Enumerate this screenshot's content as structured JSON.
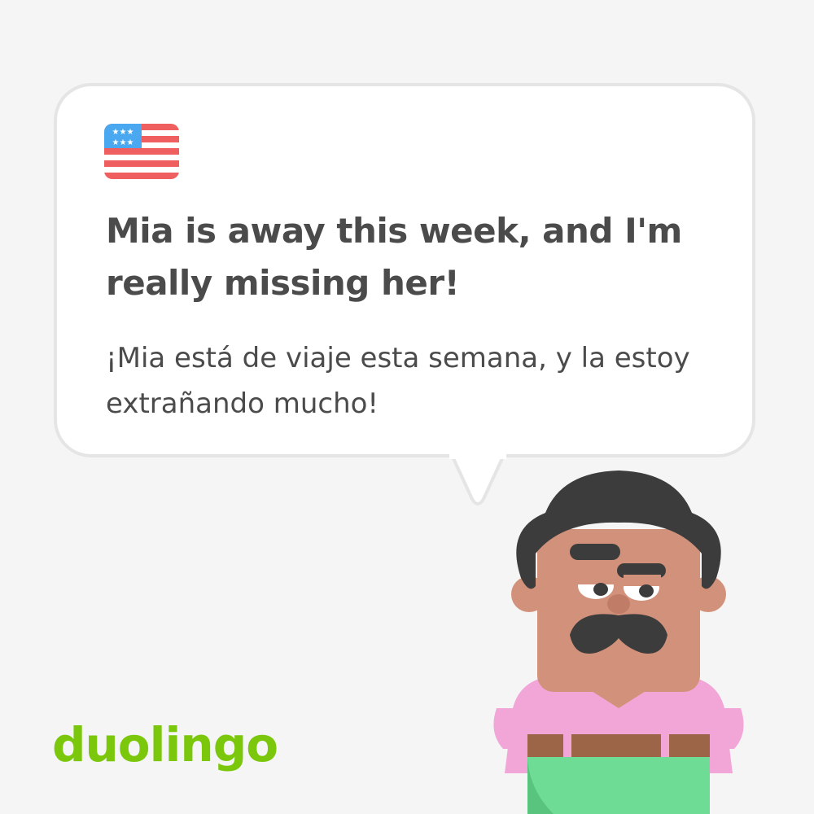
{
  "card": {
    "source_language_flag": "us-flag-icon",
    "sentence_english": "Mia is away this week, and I'm really missing her!",
    "sentence_spanish": "¡Mia está de viaje esta semana, y la estoy extrañando mucho!"
  },
  "brand": {
    "logo_text": "duolingo",
    "logo_color": "#7ac70c"
  },
  "character": {
    "name_icon": "mustached-man-character",
    "shirt_color": "#f2a6d8",
    "pants_color": "#6fdc95",
    "skin_color": "#d2917a",
    "hair_color": "#3c3c3c"
  },
  "colors": {
    "background": "#f5f5f5",
    "bubble_fill": "#ffffff",
    "bubble_border": "#e5e5e5",
    "text": "#4b4b4b"
  }
}
